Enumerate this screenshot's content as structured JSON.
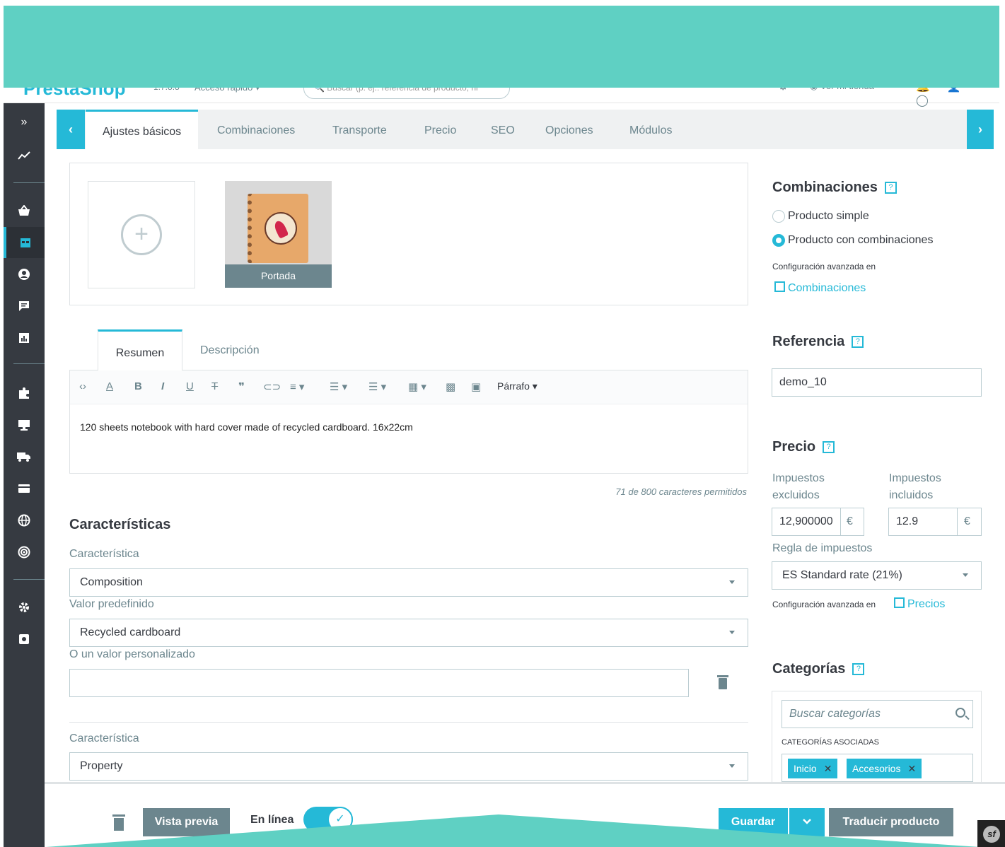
{
  "header": {
    "logo": "PrestaShop",
    "version": "1.7.8.8",
    "quick_access": "Acceso rápido ▾",
    "search_placeholder": "Buscar (p. ej.: referencia de producto, ni",
    "view_shop": "Ver mi tienda"
  },
  "sidebar": {
    "toggle_icon": "double-chevron-right-icon",
    "items": [
      "dashboard-icon",
      "orders-icon",
      "catalog-icon",
      "customers-icon",
      "messages-icon",
      "stats-icon",
      "modules-icon",
      "design-icon",
      "shipping-icon",
      "payment-icon",
      "international-icon",
      "marketing-icon",
      "settings-icon",
      "advanced-icon"
    ],
    "active": "catalog-icon"
  },
  "tabs": {
    "items": [
      "Ajustes básicos",
      "Combinaciones",
      "Transporte",
      "Precio",
      "SEO",
      "Opciones",
      "Módulos"
    ],
    "active": "Ajustes básicos"
  },
  "images": {
    "cover_label": "Portada"
  },
  "description": {
    "tabs": [
      "Resumen",
      "Descripción"
    ],
    "active": "Resumen",
    "paragraph_label": "Párrafo",
    "content": "120 sheets notebook with hard cover made of recycled cardboard. 16x22cm",
    "char_count": "71 de 800 caracteres permitidos"
  },
  "features": {
    "title": "Características",
    "feature_label": "Característica",
    "feature1_value": "Composition",
    "predefined_label": "Valor predefinido",
    "predefined_value": "Recycled cardboard",
    "custom_label": "O un valor personalizado",
    "custom_value": "",
    "feature2_label": "Característica",
    "feature2_value": "Property"
  },
  "combinations": {
    "title": "Combinaciones",
    "option_simple": "Producto simple",
    "option_combos": "Producto con combinaciones",
    "selected": "Producto con combinaciones",
    "advanced_note": "Configuración avanzada en",
    "link": "Combinaciones"
  },
  "reference": {
    "title": "Referencia",
    "value": "demo_10"
  },
  "price": {
    "title": "Precio",
    "tax_excl_label": "Impuestos excluidos",
    "tax_incl_label": "Impuestos incluidos",
    "tax_excl_value": "12,900000",
    "tax_incl_value": "12.9",
    "currency": "€",
    "tax_rule_label": "Regla de impuestos",
    "tax_rule_value": "ES Standard rate (21%)",
    "advanced_note": "Configuración avanzada en",
    "link": "Precios"
  },
  "categories": {
    "title": "Categorías",
    "search_placeholder": "Buscar categorías",
    "associated_label": "CATEGORÍAS ASOCIADAS",
    "tags": [
      "Inicio",
      "Accesorios"
    ]
  },
  "footer": {
    "preview": "Vista previa",
    "online_label": "En línea",
    "online": true,
    "save": "Guardar",
    "translate": "Traducir producto"
  },
  "colors": {
    "accent": "#25b9d7",
    "banner": "#5fd0c3",
    "sidebar": "#363a41"
  }
}
